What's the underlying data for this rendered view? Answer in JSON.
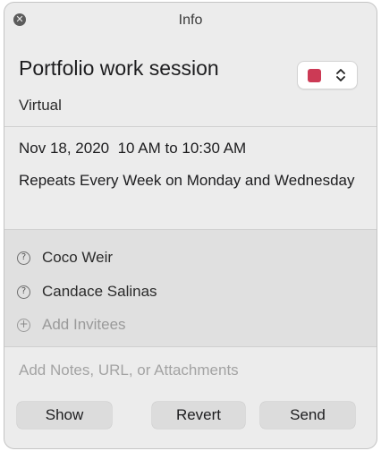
{
  "window": {
    "title": "Info",
    "close_icon": "close-icon"
  },
  "event": {
    "title": "Portfolio work session",
    "location": "Virtual",
    "color": "#cc3a55",
    "date_time": "Nov 18, 2020  10 AM to 10:30 AM",
    "repeat": "Repeats Every Week on Monday and Wednesday"
  },
  "invitees": [
    {
      "name": "Coco Weir",
      "status_icon": "question-circle-icon"
    },
    {
      "name": "Candace Salinas",
      "status_icon": "question-circle-icon"
    }
  ],
  "add_invitees": {
    "label": "Add Invitees",
    "icon": "plus-circle-icon"
  },
  "notes": {
    "placeholder": "Add Notes, URL, or Attachments"
  },
  "buttons": {
    "show": "Show",
    "revert": "Revert",
    "send": "Send"
  }
}
